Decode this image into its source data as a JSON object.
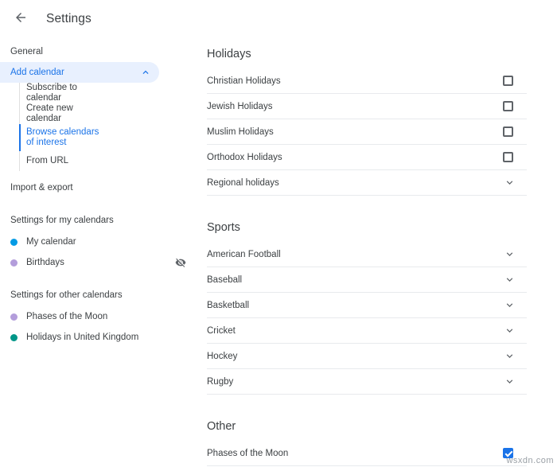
{
  "header": {
    "title": "Settings",
    "back_icon": "arrow-back-icon"
  },
  "sidebar": {
    "general_label": "General",
    "add_calendar": {
      "label": "Add calendar",
      "expanded_icon": "chevron-up-icon",
      "items": [
        {
          "label": "Subscribe to calendar",
          "active": false
        },
        {
          "label": "Create new calendar",
          "active": false
        },
        {
          "label": "Browse calendars of interest",
          "active": true
        },
        {
          "label": "From URL",
          "active": false
        }
      ]
    },
    "import_export_label": "Import & export",
    "my_calendars": {
      "title": "Settings for my calendars",
      "items": [
        {
          "label": "My calendar",
          "color": "#039be5",
          "hidden_icon": false
        },
        {
          "label": "Birthdays",
          "color": "#b39ddb",
          "hidden_icon": true
        }
      ]
    },
    "other_calendars": {
      "title": "Settings for other calendars",
      "items": [
        {
          "label": "Phases of the Moon",
          "color": "#b39ddb"
        },
        {
          "label": "Holidays in United Kingdom",
          "color": "#009688"
        }
      ]
    }
  },
  "main": {
    "sections": [
      {
        "heading": "Holidays",
        "rows": [
          {
            "label": "Christian Holidays",
            "control": "checkbox",
            "checked": false
          },
          {
            "label": "Jewish Holidays",
            "control": "checkbox",
            "checked": false
          },
          {
            "label": "Muslim Holidays",
            "control": "checkbox",
            "checked": false
          },
          {
            "label": "Orthodox Holidays",
            "control": "checkbox",
            "checked": false
          },
          {
            "label": "Regional holidays",
            "control": "expander",
            "checked": false
          }
        ]
      },
      {
        "heading": "Sports",
        "rows": [
          {
            "label": "American Football",
            "control": "expander",
            "checked": false
          },
          {
            "label": "Baseball",
            "control": "expander",
            "checked": false
          },
          {
            "label": "Basketball",
            "control": "expander",
            "checked": false
          },
          {
            "label": "Cricket",
            "control": "expander",
            "checked": false
          },
          {
            "label": "Hockey",
            "control": "expander",
            "checked": false
          },
          {
            "label": "Rugby",
            "control": "expander",
            "checked": false
          }
        ]
      },
      {
        "heading": "Other",
        "rows": [
          {
            "label": "Phases of the Moon",
            "control": "checkbox",
            "checked": true
          }
        ]
      }
    ]
  },
  "watermark": "wsxdn.com",
  "colors": {
    "accent": "#1a73e8",
    "accent_bg": "#e8f0fe",
    "text": "#3c4043",
    "icon": "#5f6368",
    "divider": "#e8eaed"
  }
}
